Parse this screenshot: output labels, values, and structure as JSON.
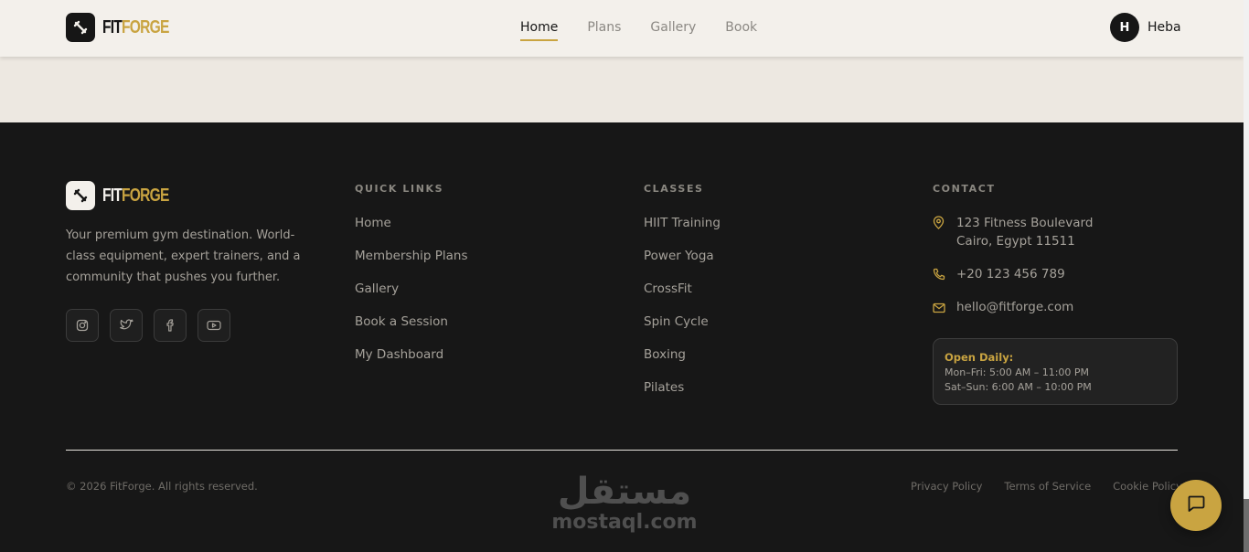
{
  "brand": {
    "name_part1": "FIT",
    "name_part2": "FORGE",
    "accent_color": "#c9a441",
    "dark_color": "#161616"
  },
  "nav": {
    "links": [
      {
        "label": "Home",
        "active": true
      },
      {
        "label": "Plans",
        "active": false
      },
      {
        "label": "Gallery",
        "active": false
      },
      {
        "label": "Book",
        "active": false
      }
    ],
    "user": {
      "initial": "H",
      "name": "Heba"
    }
  },
  "footer": {
    "tagline": "Your premium gym destination. World-class equipment, expert trainers, and a community that pushes you further.",
    "socials": [
      {
        "icon": "instagram-icon"
      },
      {
        "icon": "twitter-icon"
      },
      {
        "icon": "facebook-icon"
      },
      {
        "icon": "youtube-icon"
      }
    ],
    "quick_links": {
      "heading": "QUICK LINKS",
      "items": [
        "Home",
        "Membership Plans",
        "Gallery",
        "Book a Session",
        "My Dashboard"
      ]
    },
    "classes": {
      "heading": "CLASSES",
      "items": [
        "HIIT Training",
        "Power Yoga",
        "CrossFit",
        "Spin Cycle",
        "Boxing",
        "Pilates"
      ]
    },
    "contact": {
      "heading": "CONTACT",
      "address_line1": "123 Fitness Boulevard",
      "address_line2": "Cairo, Egypt 11511",
      "phone": "+20 123 456 789",
      "email": "hello@fitforge.com",
      "hours": {
        "title": "Open Daily:",
        "weekdays": "Mon–Fri: 5:00 AM – 11:00 PM",
        "weekend": "Sat–Sun: 6:00 AM – 10:00 PM"
      }
    },
    "copyright": "© 2026 FitForge. All rights reserved.",
    "legal": [
      "Privacy Policy",
      "Terms of Service",
      "Cookie Policy"
    ]
  },
  "watermark": {
    "arabic": "مستقل",
    "latin": "mostaql.com"
  },
  "chat": {
    "icon": "chat-icon"
  }
}
